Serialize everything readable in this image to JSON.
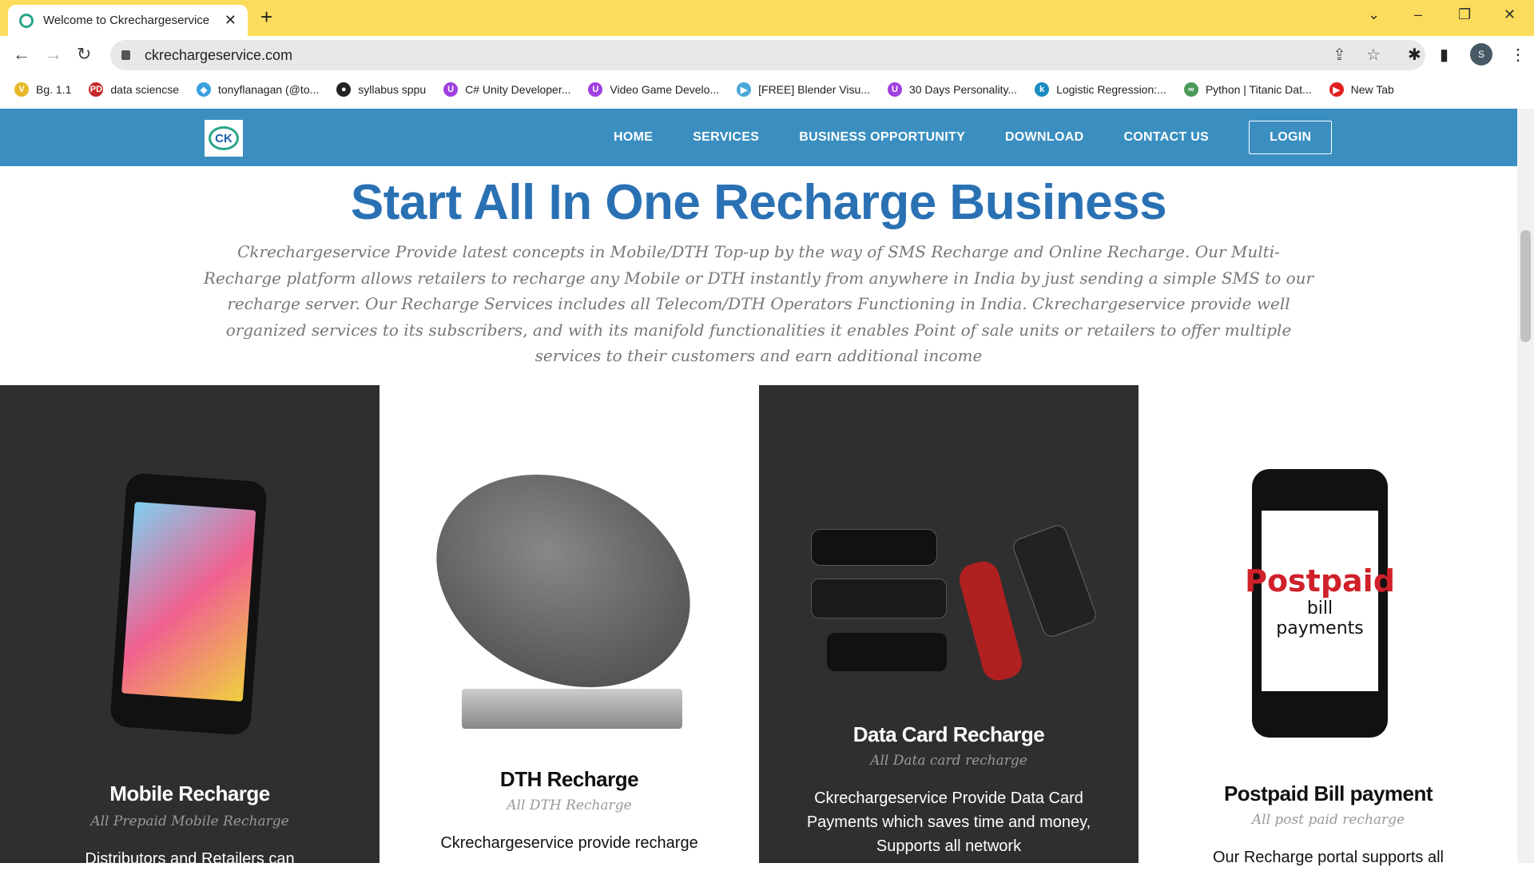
{
  "browser": {
    "tab_title": "Welcome to Ckrechargeservice",
    "url": "ckrechargeservice.com",
    "avatar": "S",
    "bookmarks": [
      {
        "label": "Bg. 1.1",
        "icon": "V",
        "color": "#e8b828"
      },
      {
        "label": "data sciencse",
        "icon": "PD",
        "color": "#c62828"
      },
      {
        "label": "tonyflanagan (@to...",
        "icon": "◆",
        "color": "#3aa0e0"
      },
      {
        "label": "syllabus sppu",
        "icon": "●",
        "color": "#222222"
      },
      {
        "label": "C# Unity Developer...",
        "icon": "U",
        "color": "#a040e0"
      },
      {
        "label": "Video Game Develo...",
        "icon": "U",
        "color": "#a040e0"
      },
      {
        "label": "[FREE] Blender Visu...",
        "icon": "▶",
        "color": "#4aa8d8"
      },
      {
        "label": "30 Days Personality...",
        "icon": "U",
        "color": "#a040e0"
      },
      {
        "label": "Logistic Regression:...",
        "icon": "k",
        "color": "#1a8cc0"
      },
      {
        "label": "Python | Titanic Dat...",
        "icon": "∞",
        "color": "#4a9a5a"
      },
      {
        "label": "New Tab",
        "icon": "▶",
        "color": "#e02020"
      }
    ]
  },
  "site": {
    "logo": "CK",
    "menu": [
      "HOME",
      "SERVICES",
      "BUSINESS OPPORTUNITY",
      "DOWNLOAD",
      "CONTACT US"
    ],
    "login": "LOGIN",
    "heading": "Start All In One Recharge Business",
    "intro": "Ckrechargeservice Provide latest concepts in Mobile/DTH Top-up by the way of SMS Recharge and Online Recharge. Our Multi-Recharge platform allows retailers to recharge any Mobile or DTH instantly from anywhere in India by just sending a simple SMS to our recharge server. Our Recharge Services includes all Telecom/DTH Operators Functioning in India. Ckrechargeservice provide well organized services to its subscribers, and with its manifold functionalities it enables Point of sale units or retailers to offer multiple services to their customers and earn additional income",
    "cards": [
      {
        "title": "Mobile Recharge",
        "subtitle": "All Prepaid Mobile Recharge",
        "desc": "Distributors and Retailers can"
      },
      {
        "title": "DTH Recharge",
        "subtitle": "All DTH Recharge",
        "desc": "Ckrechargeservice provide recharge"
      },
      {
        "title": "Data Card Recharge",
        "subtitle": "All Data card recharge",
        "desc": "Ckrechargeservice Provide Data Card Payments which saves time and money, Supports all network"
      },
      {
        "title": "Postpaid Bill payment",
        "subtitle": "All post paid recharge",
        "desc": "Our Recharge portal supports all",
        "image_text": [
          "Postpaid",
          "bill payments"
        ]
      }
    ]
  },
  "colors": {
    "nav": "#3a8fc0",
    "heading": "#2a71b4",
    "card_dark": "#2f2f2f",
    "tabbar": "#fcdc5c"
  }
}
